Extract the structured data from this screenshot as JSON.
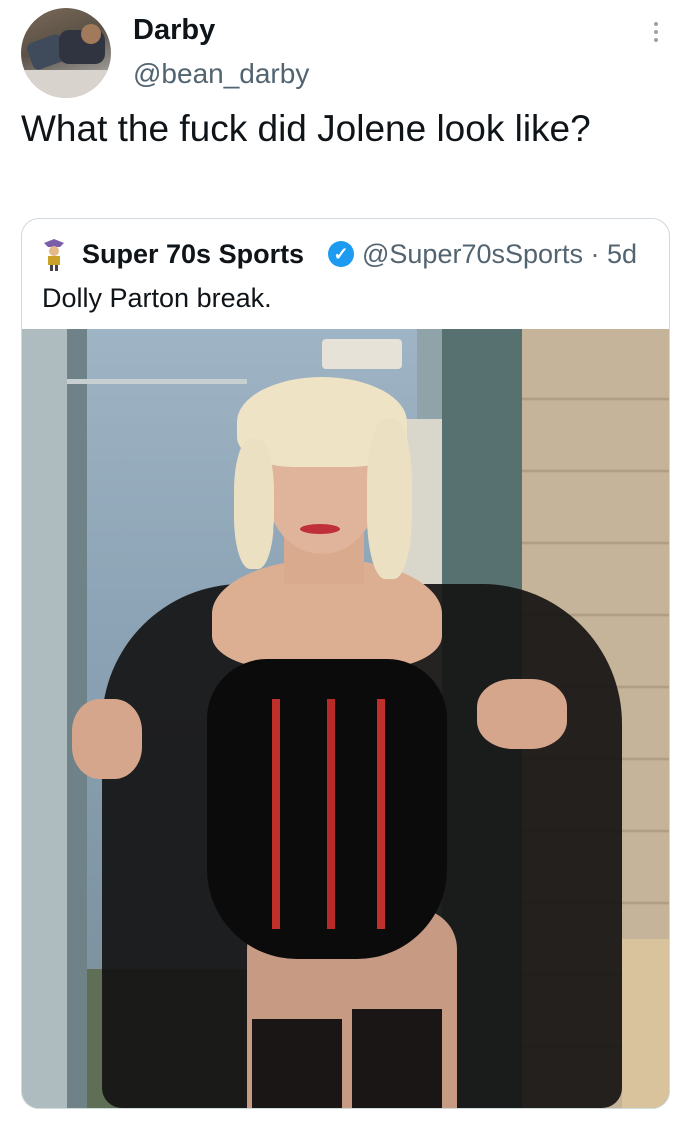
{
  "author": {
    "name": "Darby",
    "handle": "@bean_darby"
  },
  "tweet": {
    "text": "What the fuck did Jolene look like?"
  },
  "quoted": {
    "name": "Super 70s Sports",
    "verified_glyph": "✓",
    "handle_meta": "@Super70sSports · 5d",
    "text": "Dolly Parton break."
  },
  "icons": {
    "more": "more-vertical-icon",
    "verified": "verified-badge-icon"
  },
  "colors": {
    "text": "#0f1419",
    "secondary": "#536471",
    "accent": "#1d9bf0",
    "border": "#cfd9de"
  }
}
